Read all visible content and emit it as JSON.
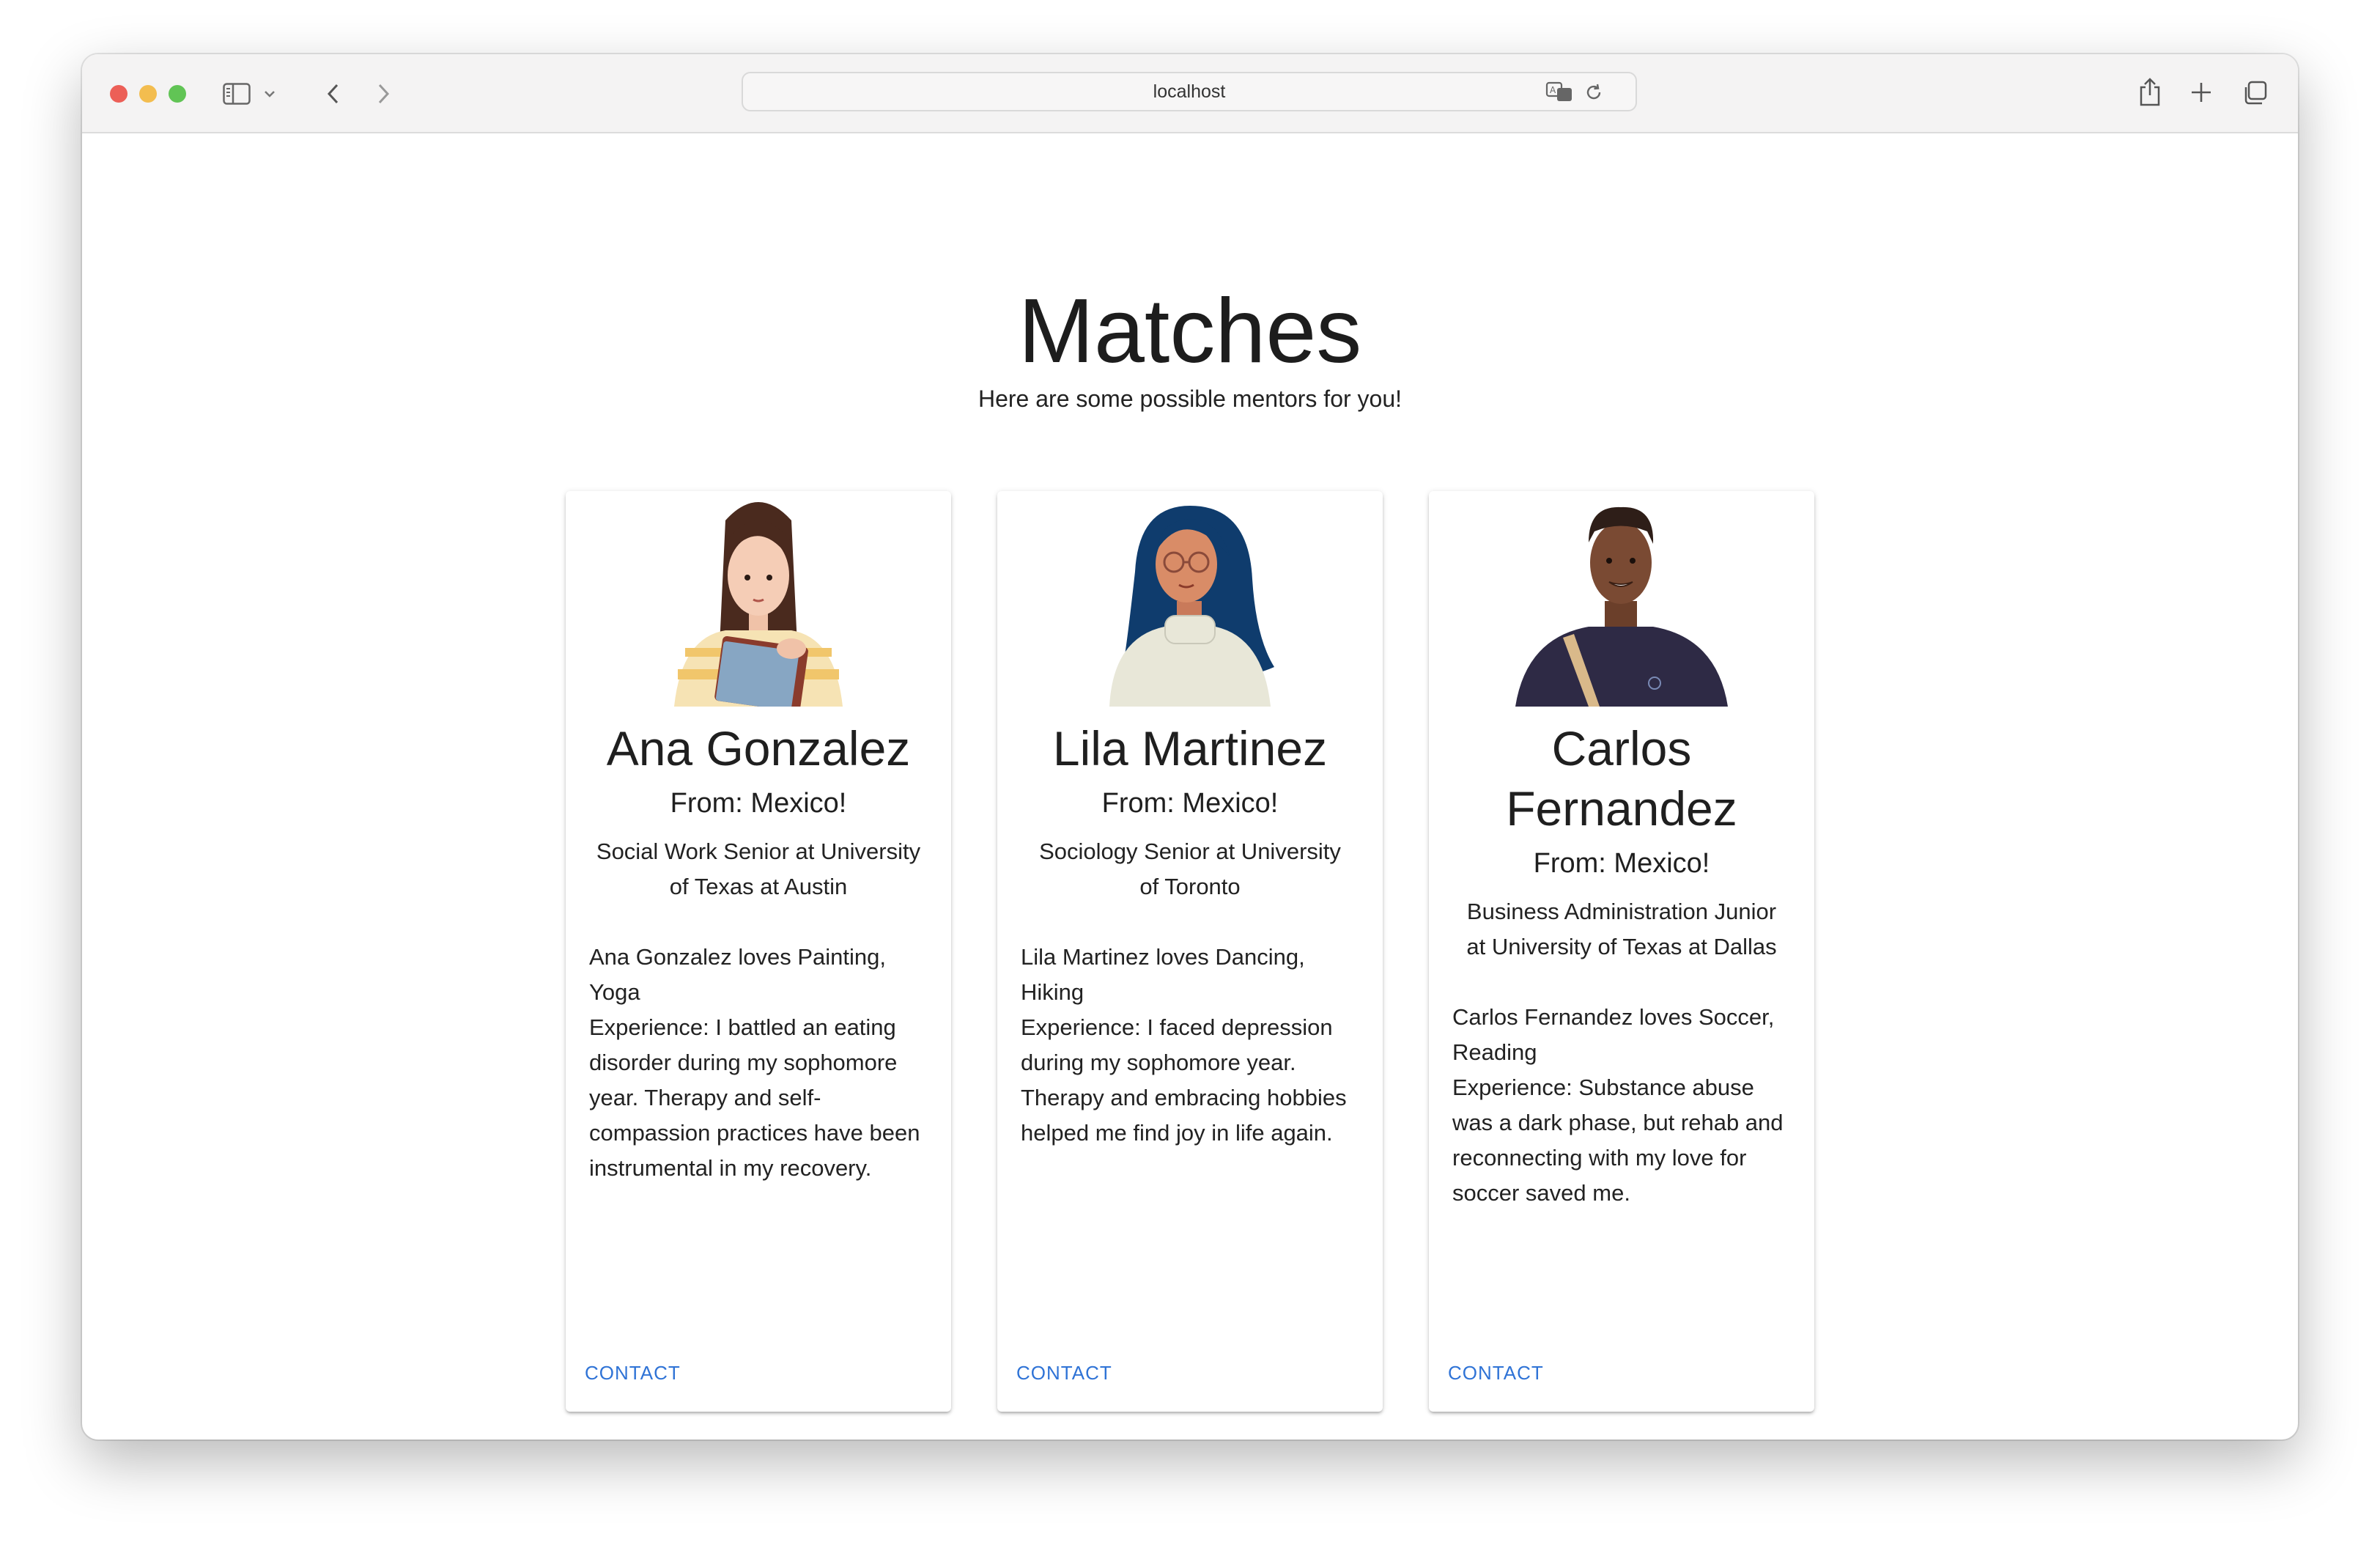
{
  "browser": {
    "url": "localhost"
  },
  "page": {
    "title": "Matches",
    "subtitle": "Here are some possible mentors for you!"
  },
  "mentors": [
    {
      "name": "Ana Gonzalez",
      "from": "From: Mexico!",
      "school": "Social Work Senior at University of Texas at Austin",
      "loves": "Ana Gonzalez loves Painting, Yoga",
      "experience": "Experience: I battled an eating disorder during my sophomore year. Therapy and self-compassion practices have been instrumental in my recovery.",
      "contact_label": "CONTACT"
    },
    {
      "name": "Lila Martinez",
      "from": "From: Mexico!",
      "school": "Sociology Senior at University of Toronto",
      "loves": "Lila Martinez loves Dancing, Hiking",
      "experience": "Experience: I faced depression during my sophomore year. Therapy and embracing hobbies helped me find joy in life again.",
      "contact_label": "CONTACT"
    },
    {
      "name": "Carlos Fernandez",
      "from": "From: Mexico!",
      "school": "Business Administration Junior at University of Texas at Dallas",
      "loves": "Carlos Fernandez loves Soccer, Reading",
      "experience": "Experience: Substance abuse was a dark phase, but rehab and reconnecting with my love for soccer saved me.",
      "contact_label": "CONTACT"
    }
  ],
  "colors": {
    "accent": "#2f73d6",
    "traffic_red": "#ec5f57",
    "traffic_yellow": "#f3bd4f",
    "traffic_green": "#61c455"
  },
  "icons": [
    "sidebar-icon",
    "chevron-down-icon",
    "back-icon",
    "forward-icon",
    "translate-icon",
    "reload-icon",
    "share-icon",
    "new-tab-icon",
    "tabs-overview-icon"
  ]
}
